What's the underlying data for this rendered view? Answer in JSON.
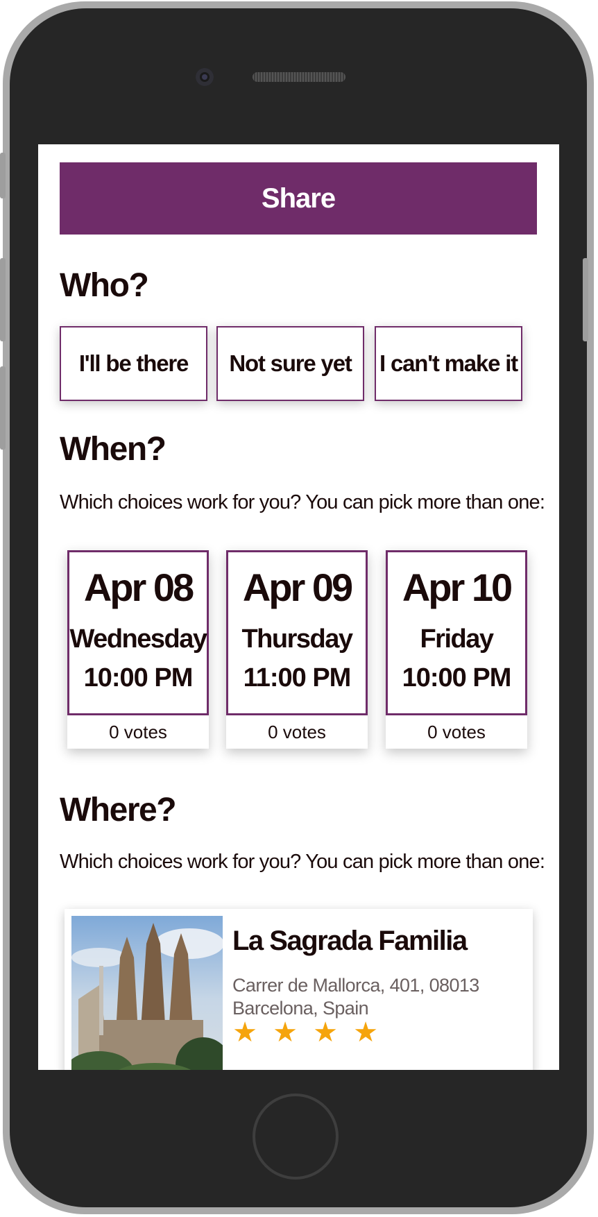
{
  "share": {
    "label": "Share"
  },
  "who": {
    "heading": "Who?",
    "options": [
      {
        "label": "I'll be there"
      },
      {
        "label": "Not sure yet"
      },
      {
        "label": "I can't make it"
      }
    ]
  },
  "when": {
    "heading": "When?",
    "instructions": "Which choices work for you? You can pick more than one:",
    "options": [
      {
        "date": "Apr 08",
        "day": "Wednesday",
        "time": "10:00 PM",
        "votes": "0 votes"
      },
      {
        "date": "Apr 09",
        "day": "Thursday",
        "time": "11:00 PM",
        "votes": "0 votes"
      },
      {
        "date": "Apr 10",
        "day": "Friday",
        "time": "10:00 PM",
        "votes": "0 votes"
      }
    ]
  },
  "where": {
    "heading": "Where?",
    "instructions": "Which choices work for you? You can pick more than one:",
    "places": [
      {
        "name": "La Sagrada Familia",
        "address": "Carrer de Mallorca, 401, 08013 Barcelona, Spain",
        "rating_stars": 4,
        "photo_icon": "basilica-photo"
      }
    ]
  },
  "colors": {
    "accent": "#6f2c69",
    "star": "#f5a40c",
    "text": "#1a0a0a"
  }
}
